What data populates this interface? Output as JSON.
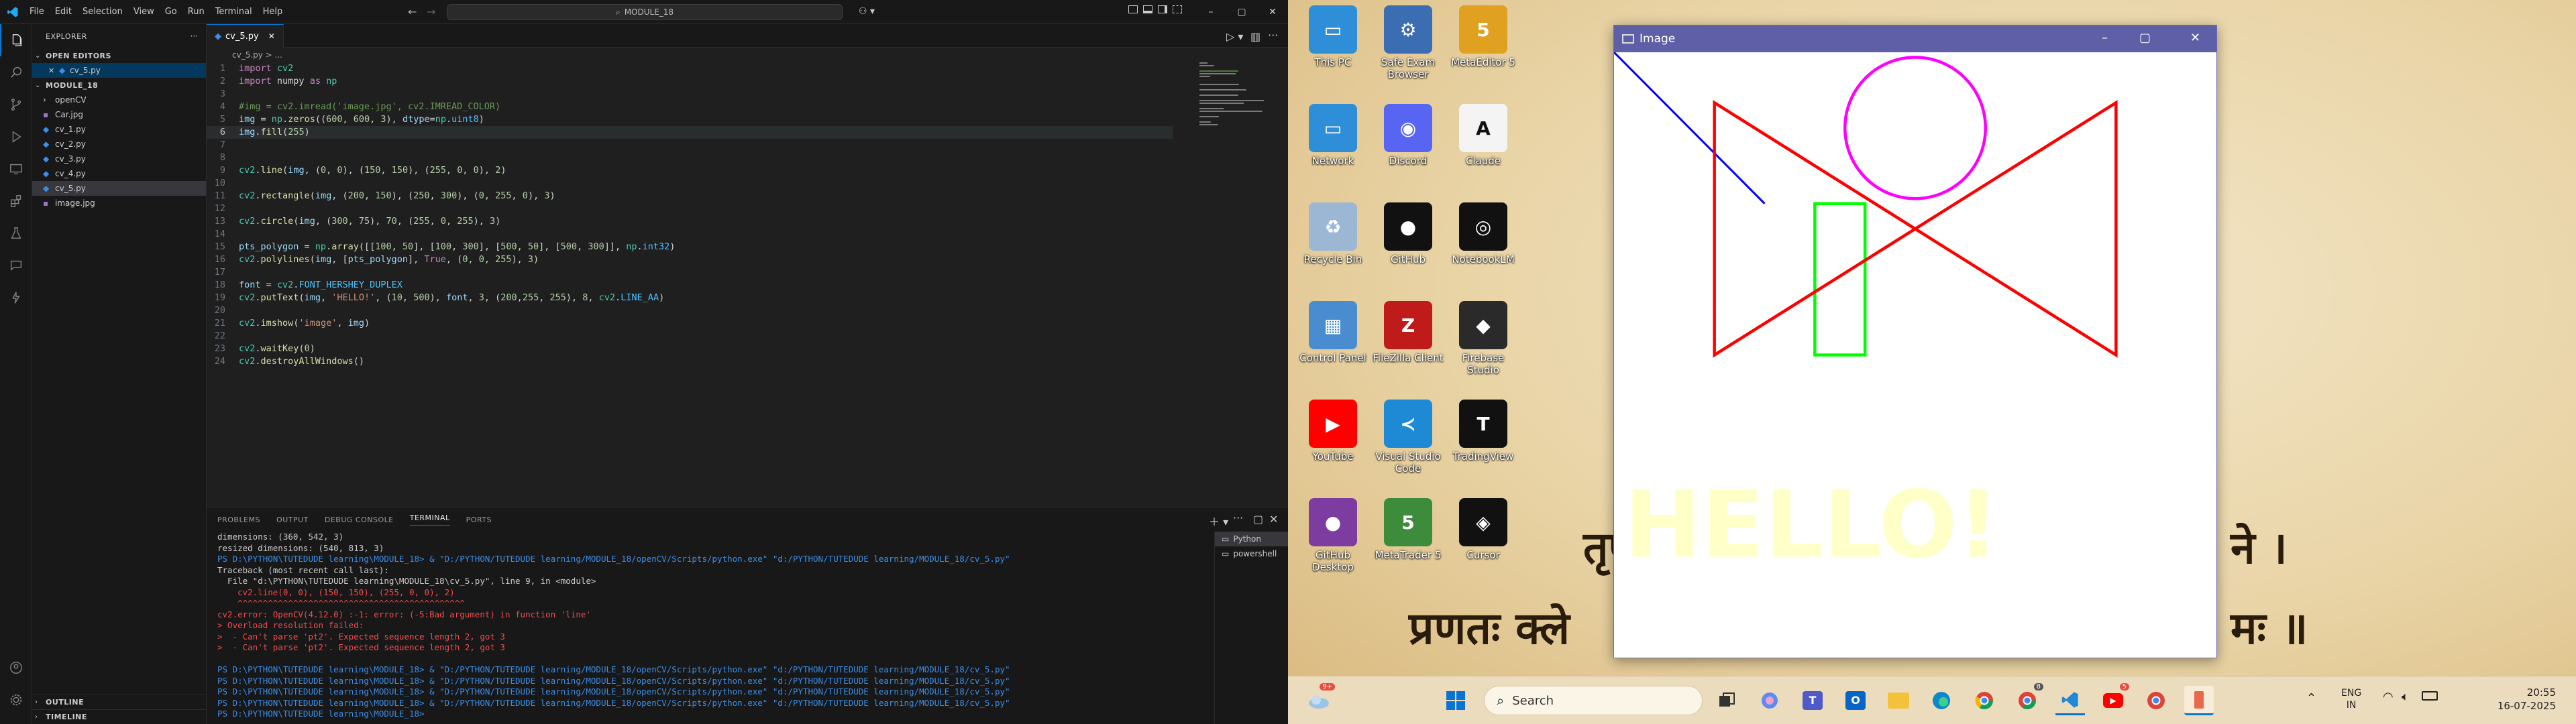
{
  "vscode": {
    "menu": [
      "File",
      "Edit",
      "Selection",
      "View",
      "Go",
      "Run",
      "Terminal",
      "Help"
    ],
    "command_center": "MODULE_18",
    "explorer_title": "EXPLORER",
    "open_editors_label": "OPEN EDITORS",
    "open_editor_file": "cv_5.py",
    "workspace_label": "MODULE_18",
    "tree": [
      {
        "name": "openCV",
        "type": "folder"
      },
      {
        "name": "Car.jpg",
        "type": "image"
      },
      {
        "name": "cv_1.py",
        "type": "py"
      },
      {
        "name": "cv_2.py",
        "type": "py"
      },
      {
        "name": "cv_3.py",
        "type": "py"
      },
      {
        "name": "cv_4.py",
        "type": "py"
      },
      {
        "name": "cv_5.py",
        "type": "py"
      },
      {
        "name": "image.jpg",
        "type": "image"
      }
    ],
    "outline_label": "OUTLINE",
    "timeline_label": "TIMELINE",
    "tab_label": "cv_5.py",
    "breadcrumb": "cv_5.py > ...",
    "code_lines": [
      "import cv2",
      "import numpy as np",
      "",
      "#img = cv2.imread('image.jpg', cv2.IMREAD_COLOR)",
      "img = np.zeros((600, 600, 3), dtype=np.uint8)",
      "img.fill(255)",
      "",
      "",
      "cv2.line(img, (0, 0), (150, 150), (255, 0, 0), 2)",
      "",
      "cv2.rectangle(img, (200, 150), (250, 300), (0, 255, 0), 3)",
      "",
      "cv2.circle(img, (300, 75), 70, (255, 0, 255), 3)",
      "",
      "pts_polygon = np.array([[100, 50], [100, 300], [500, 50], [500, 300]], np.int32)",
      "cv2.polylines(img, [pts_polygon], True, (0, 0, 255), 3)",
      "",
      "font = cv2.FONT_HERSHEY_DUPLEX",
      "cv2.putText(img, 'HELLO!', (10, 500), font, 3, (200,255, 255), 8, cv2.LINE_AA)",
      "",
      "cv2.imshow('image', img)",
      "",
      "cv2.waitKey(0)",
      "cv2.destroyAllWindows()"
    ],
    "panel_tabs": [
      "PROBLEMS",
      "OUTPUT",
      "DEBUG CONSOLE",
      "TERMINAL",
      "PORTS"
    ],
    "active_panel_tab": "TERMINAL",
    "terminal_lines": [
      {
        "t": "dimensions: (360, 542, 3)",
        "c": ""
      },
      {
        "t": "resized dimensions: (540, 813, 3)",
        "c": ""
      },
      {
        "t": "PS D:\\PYTHON\\TUTEDUDE learning\\MODULE_18> & \"D:/PYTHON/TUTEDUDE learning/MODULE_18/openCV/Scripts/python.exe\" \"d:/PYTHON/TUTEDUDE learning/MODULE_18/cv_5.py\"",
        "c": "blu"
      },
      {
        "t": "Traceback (most recent call last):",
        "c": ""
      },
      {
        "t": "  File \"d:\\PYTHON\\TUTEDUDE learning\\MODULE_18\\cv_5.py\", line 9, in <module>",
        "c": ""
      },
      {
        "t": "    cv2.line(0, 0), (150, 150), (255, 0, 0), 2)",
        "c": "red"
      },
      {
        "t": "    ^^^^^^^^^^^^^^^^^^^^^^^^^^^^^^^^^^^^^^^^^^^^^",
        "c": "red"
      },
      {
        "t": "cv2.error: OpenCV(4.12.0) :-1: error: (-5:Bad argument) in function 'line'",
        "c": "red"
      },
      {
        "t": "> Overload resolution failed:",
        "c": "red"
      },
      {
        "t": ">  - Can't parse 'pt2'. Expected sequence length 2, got 3",
        "c": "red"
      },
      {
        "t": ">  - Can't parse 'pt2'. Expected sequence length 2, got 3",
        "c": "red"
      },
      {
        "t": "",
        "c": ""
      },
      {
        "t": "PS D:\\PYTHON\\TUTEDUDE learning\\MODULE_18> & \"D:/PYTHON/TUTEDUDE learning/MODULE_18/openCV/Scripts/python.exe\" \"d:/PYTHON/TUTEDUDE learning/MODULE_18/cv_5.py\"",
        "c": "blu"
      },
      {
        "t": "PS D:\\PYTHON\\TUTEDUDE learning\\MODULE_18> & \"D:/PYTHON/TUTEDUDE learning/MODULE_18/openCV/Scripts/python.exe\" \"d:/PYTHON/TUTEDUDE learning/MODULE_18/cv_5.py\"",
        "c": "blu"
      },
      {
        "t": "PS D:\\PYTHON\\TUTEDUDE learning\\MODULE_18> & \"D:/PYTHON/TUTEDUDE learning/MODULE_18/openCV/Scripts/python.exe\" \"d:/PYTHON/TUTEDUDE learning/MODULE_18/cv_5.py\"",
        "c": "blu"
      },
      {
        "t": "PS D:\\PYTHON\\TUTEDUDE learning\\MODULE_18> & \"D:/PYTHON/TUTEDUDE learning/MODULE_18/openCV/Scripts/python.exe\" \"d:/PYTHON/TUTEDUDE learning/MODULE_18/cv_5.py\"",
        "c": "blu"
      },
      {
        "t": "PS D:\\PYTHON\\TUTEDUDE learning\\MODULE_18> ",
        "c": "blu"
      }
    ],
    "terminal_list": [
      "Python",
      "powershell"
    ]
  },
  "desktop": {
    "icons": [
      {
        "label": "This PC",
        "color": "#2e8fd8",
        "glyph": "▭"
      },
      {
        "label": "Safe Exam Browser",
        "color": "#3b6db3",
        "glyph": "⚙"
      },
      {
        "label": "MetaEditor 5",
        "color": "#e0a020",
        "glyph": "5"
      },
      {
        "label": "Network",
        "color": "#2e8fd8",
        "glyph": "▭"
      },
      {
        "label": "Discord",
        "color": "#5865f2",
        "glyph": "◉"
      },
      {
        "label": "Claude",
        "color": "#f4f4f4",
        "glyph": "A"
      },
      {
        "label": "Recycle Bin",
        "color": "#9bb7d4",
        "glyph": "♻"
      },
      {
        "label": "GitHub",
        "color": "#111111",
        "glyph": "●"
      },
      {
        "label": "NotebookLM",
        "color": "#111111",
        "glyph": "◎"
      },
      {
        "label": "Control Panel",
        "color": "#4a8cd0",
        "glyph": "▦"
      },
      {
        "label": "FileZilla Client",
        "color": "#bf1b1b",
        "glyph": "Z"
      },
      {
        "label": "Firebase Studio",
        "color": "#2a2a2a",
        "glyph": "◆"
      },
      {
        "label": "YouTube",
        "color": "#ff0000",
        "glyph": "▶"
      },
      {
        "label": "Visual Studio Code",
        "color": "#1e8ad6",
        "glyph": "≺"
      },
      {
        "label": "TradingView",
        "color": "#111111",
        "glyph": "T"
      },
      {
        "label": "GitHub Desktop",
        "color": "#7c3ca0",
        "glyph": "●"
      },
      {
        "label": "MetaTrader 5",
        "color": "#3c8c3c",
        "glyph": "5"
      },
      {
        "label": "Cursor",
        "color": "#111111",
        "glyph": "◈"
      }
    ],
    "wallpaper_line1": "तृणाद",
    "wallpaper_line1_end": "ने ।",
    "wallpaper_line2": "प्रणतः क्ले",
    "wallpaper_line2_end": "मः ॥"
  },
  "image_window": {
    "title": "Image",
    "text": "HELLO!",
    "text_color": "#ffffc8",
    "line_color": "#0000ff",
    "rect_color": "#00ff00",
    "circle_color": "#ff00ff",
    "polygon_color": "#ff0000"
  },
  "taskbar": {
    "search_placeholder": "Search",
    "lang_line1": "ENG",
    "lang_line2": "IN",
    "time": "20:55",
    "date": "16-07-2025",
    "weather_badge": "9+",
    "badge_chrome": "8",
    "badge_yt": "5"
  }
}
